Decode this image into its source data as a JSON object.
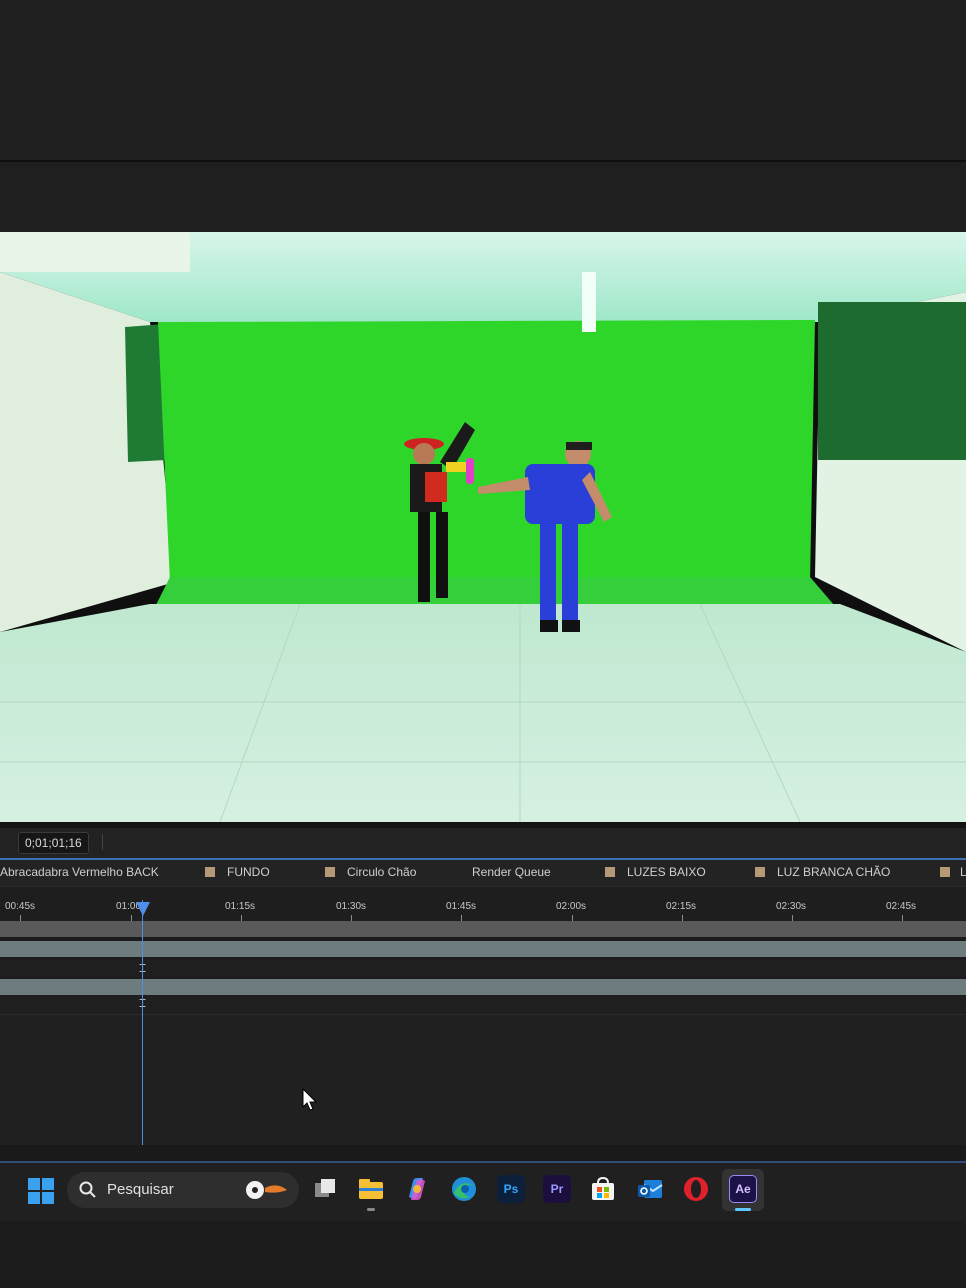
{
  "viewer": {
    "timecode": "0;01;01;16"
  },
  "timeline": {
    "tabs": [
      {
        "label": "Abracadabra Vermelho BACK",
        "swatch": false
      },
      {
        "label": "FUNDO",
        "swatch": true
      },
      {
        "label": "Circulo Chão",
        "swatch": true
      },
      {
        "label": "Render Queue",
        "swatch": false
      },
      {
        "label": "LUZES BAIXO",
        "swatch": true
      },
      {
        "label": "LUZ BRANCA CHÃO",
        "swatch": true
      },
      {
        "label": "L",
        "swatch": true
      }
    ],
    "ruler_ticks": [
      "00:45s",
      "01:00s",
      "01:15s",
      "01:30s",
      "01:45s",
      "02:00s",
      "02:15s",
      "02:30s",
      "02:45s"
    ],
    "playhead_time": "01:01",
    "colors": {
      "accent": "#4f8ee8",
      "tab_swatch": "#b59a78",
      "track_bar": "#6e7c80"
    }
  },
  "taskbar": {
    "search_placeholder": "Pesquisar",
    "apps": [
      "task-view",
      "file-explorer",
      "copilot",
      "edge",
      "photoshop",
      "premiere-pro",
      "microsoft-store",
      "outlook",
      "opera",
      "after-effects"
    ],
    "icon_labels": {
      "photoshop": "Ps",
      "premiere": "Pr",
      "after_effects": "Ae"
    },
    "active_app": "after-effects"
  }
}
